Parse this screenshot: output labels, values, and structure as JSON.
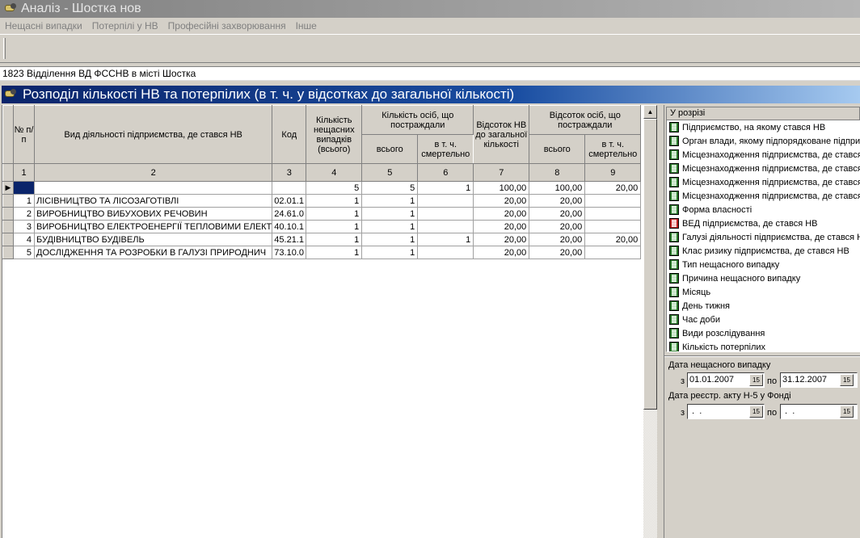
{
  "window": {
    "title": "Аналіз - Шостка нов",
    "icon": "app-icon"
  },
  "menu": [
    "Нещасні випадки",
    "Потерпілі у НВ",
    "Професійні захворювання",
    "Інше"
  ],
  "org_line": "1823 Відділення ВД ФССНВ в місті Шостка",
  "report": {
    "title": "Розподіл кількості НВ та потерпілих (в т. ч. у відсотках до загальної кількості)"
  },
  "table": {
    "headers": {
      "num": "№ п/п",
      "activity": "Вид діяльності підприємства, де стався НВ",
      "code": "Код",
      "cases": "Кількість нещасних випадків (всього)",
      "persons": "Кількість осіб, що постраждали",
      "persons_total": "всього",
      "persons_fatal": "в т. ч. смертельно",
      "pct_cases": "Відсоток НВ до загальної кількості",
      "pct_persons": "Відсоток осіб, що постраждали",
      "pct_total": "всього",
      "pct_fatal": "в т. ч. смертельно"
    },
    "col_numbers": [
      "1",
      "2",
      "3",
      "4",
      "5",
      "6",
      "7",
      "8",
      "9"
    ],
    "total_row": {
      "n": "",
      "activity": "",
      "code": "",
      "cases": "5",
      "persons": "5",
      "fatal": "1",
      "pct_cases": "100,00",
      "pct_persons": "100,00",
      "pct_fatal": "20,00"
    },
    "rows": [
      {
        "n": "1",
        "activity": "ЛІСІВНИЦТВО ТА ЛІСОЗАГОТІВЛІ",
        "code": "02.01.1",
        "cases": "1",
        "persons": "1",
        "fatal": "",
        "pct_cases": "20,00",
        "pct_persons": "20,00",
        "pct_fatal": ""
      },
      {
        "n": "2",
        "activity": "ВИРОБНИЦТВО ВИБУХОВИХ РЕЧОВИН",
        "code": "24.61.0",
        "cases": "1",
        "persons": "1",
        "fatal": "",
        "pct_cases": "20,00",
        "pct_persons": "20,00",
        "pct_fatal": ""
      },
      {
        "n": "3",
        "activity": "ВИРОБНИЦТВО ЕЛЕКТРОЕНЕРГІЇ ТЕПЛОВИМИ ЕЛЕКТ",
        "code": "40.10.1",
        "cases": "1",
        "persons": "1",
        "fatal": "",
        "pct_cases": "20,00",
        "pct_persons": "20,00",
        "pct_fatal": ""
      },
      {
        "n": "4",
        "activity": "БУДІВНИЦТВО БУДІВЕЛЬ",
        "code": "45.21.1",
        "cases": "1",
        "persons": "1",
        "fatal": "1",
        "pct_cases": "20,00",
        "pct_persons": "20,00",
        "pct_fatal": "20,00"
      },
      {
        "n": "5",
        "activity": "ДОСЛІДЖЕННЯ ТА РОЗРОБКИ В ГАЛУЗІ ПРИРОДНИЧ",
        "code": "73.10.0",
        "cases": "1",
        "persons": "1",
        "fatal": "",
        "pct_cases": "20,00",
        "pct_persons": "20,00",
        "pct_fatal": ""
      }
    ]
  },
  "side": {
    "list_header": "У розрізі",
    "items": [
      {
        "label": "Підприємство, на якому стався НВ",
        "icon": "green-book-icon"
      },
      {
        "label": "Орган влади, якому підпорядковане підприємство",
        "icon": "green-book-icon"
      },
      {
        "label": "Місцезнаходження підприємства, де стався НВ",
        "icon": "green-book-icon"
      },
      {
        "label": "Місцезнаходження підприємства, де стався НВ",
        "icon": "green-book-icon"
      },
      {
        "label": "Місцезнаходження підприємства, де стався НВ",
        "icon": "green-book-icon"
      },
      {
        "label": "Місцезнаходження підприємства, де стався НВ",
        "icon": "green-book-icon"
      },
      {
        "label": "Форма власності",
        "icon": "green-book-icon"
      },
      {
        "label": "ВЕД підприємства, де стався НВ",
        "icon": "red-book-icon"
      },
      {
        "label": "Галузі діяльності підприємства, де стався НВ",
        "icon": "green-book-icon"
      },
      {
        "label": "Клас ризику підприємства, де стався НВ",
        "icon": "green-book-icon"
      },
      {
        "label": "Тип нещасного випадку",
        "icon": "green-book-icon"
      },
      {
        "label": "Причина нещасного випадку",
        "icon": "green-book-icon"
      },
      {
        "label": "Місяць",
        "icon": "green-book-icon"
      },
      {
        "label": "День тижня",
        "icon": "green-book-icon"
      },
      {
        "label": "Час доби",
        "icon": "green-book-icon"
      },
      {
        "label": "Види розслідування",
        "icon": "green-book-icon"
      },
      {
        "label": "Кількість потерпілих",
        "icon": "green-book-icon"
      }
    ],
    "accident_date": {
      "label": "Дата нещасного випадку",
      "from_label": "з",
      "to_label": "по",
      "from": "01.01.2007",
      "to": "31.12.2007"
    },
    "act_date": {
      "label": "Дата реєстр. акту Н-5 у Фонді",
      "from_label": "з",
      "to_label": "по",
      "from": " .  .",
      "to": " .  ."
    },
    "calendar_button": "15"
  }
}
